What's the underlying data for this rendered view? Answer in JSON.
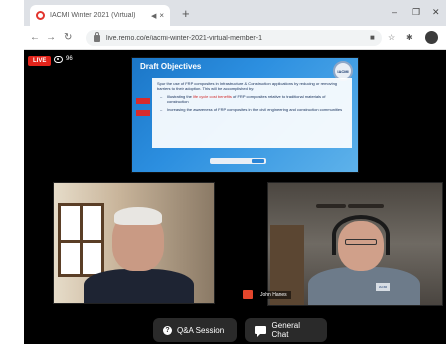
{
  "browser": {
    "tab_title": "IACMI Winter 2021 (Virtual)",
    "tab_speaker": "◀",
    "tab_close": "×",
    "new_tab": "+",
    "window_controls": [
      "–",
      "❐",
      "✕"
    ],
    "nav_back": "←",
    "nav_forward": "→",
    "nav_reload": "↻",
    "url": "live.remo.co/e/iacmi-winter-2021-virtual-member-1",
    "toolbar_icons": [
      "■",
      "☆",
      "✱"
    ]
  },
  "stream": {
    "live_label": "LIVE",
    "viewer_count": "96"
  },
  "slide": {
    "title": "Draft Objectives",
    "logo_text": "IACMI",
    "intro": "Spur the use of FRP composites in Infrastructure & Construction applications by reducing or removing barriers to their adoption. This will be accomplished by:",
    "bullets": [
      {
        "before": "Illustrating the ",
        "highlight": "life cycle cost benefits",
        "after": " of FRP composites relative to traditional materials of construction"
      },
      {
        "before": "Increasing the awareness of FRP composites in the civil engineering and construction communities",
        "highlight": "",
        "after": ""
      }
    ]
  },
  "participants": {
    "right_name": "John Hanes",
    "shirt_logo": "IACMI"
  },
  "buttons": {
    "qa_label": "Q&A Session",
    "chat_label": "General Chat"
  },
  "icons": {
    "qa": "?",
    "live": "live-badge",
    "chat": "chat-icon"
  },
  "colors": {
    "live_red": "#e3241b",
    "slide_blue": "#1b76c7",
    "pill_bg": "#2a2a2a"
  }
}
